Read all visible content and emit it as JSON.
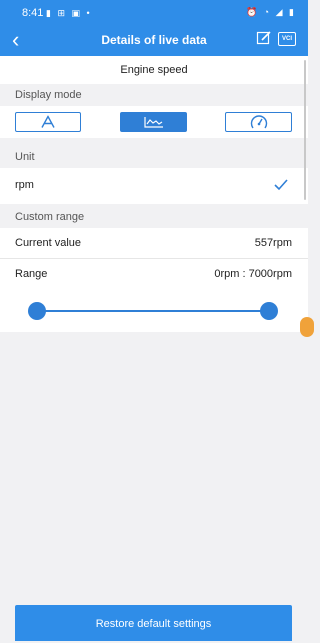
{
  "status_bar": {
    "time": "8:41",
    "icons": "▮ ⊞ ▣ •",
    "right_icons": "⏰ ◔ ◢ ▮"
  },
  "app_bar": {
    "back": "‹",
    "title": "Details of live data",
    "vci_label": "VCI"
  },
  "subtitle": "Engine speed",
  "display_mode": {
    "header": "Display mode",
    "modes": [
      {
        "name": "text",
        "icon": "text-a-icon",
        "selected": false
      },
      {
        "name": "chart",
        "icon": "line-chart-icon",
        "selected": true
      },
      {
        "name": "gauge",
        "icon": "gauge-icon",
        "selected": false
      }
    ]
  },
  "unit": {
    "header": "Unit",
    "value": "rpm",
    "checked": true
  },
  "custom_range": {
    "header": "Custom range",
    "current_label": "Current value",
    "current_value": "557rpm",
    "range_label": "Range",
    "range_value": "0rpm : 7000rpm",
    "slider": {
      "min": 0,
      "max": 7000,
      "low": 0,
      "high": 7000
    }
  },
  "restore_button": "Restore default settings",
  "colors": {
    "accent": "#2f8de8",
    "accent_dark": "#2f7fd6"
  }
}
